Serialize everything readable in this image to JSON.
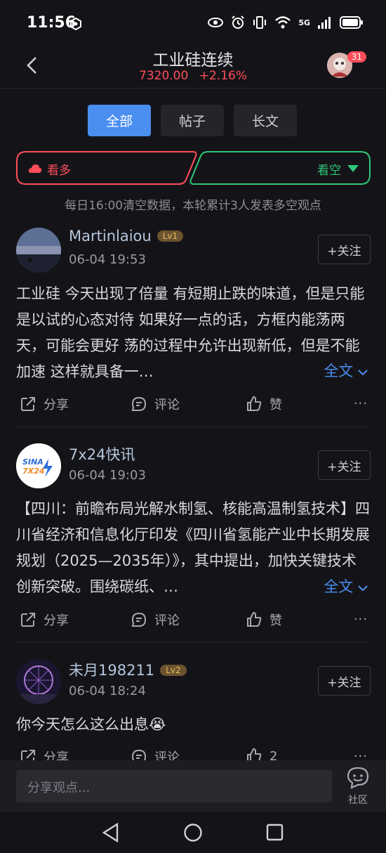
{
  "status_bar": {
    "time": "11:56",
    "network": "5G"
  },
  "header": {
    "title": "工业硅连续",
    "price": "7320.00",
    "change": "+2.16%",
    "notification_count": "31"
  },
  "tabs": [
    {
      "label": "全部",
      "active": true
    },
    {
      "label": "帖子",
      "active": false
    },
    {
      "label": "长文",
      "active": false
    }
  ],
  "sentiment": {
    "bull_label": "看多",
    "bear_label": "看空",
    "note": "每日16:00清空数据，本轮累计3人发表多空观点",
    "bull_color": "#ff4d5a",
    "bear_color": "#2ec777"
  },
  "posts": [
    {
      "username": "Martinlaiou",
      "level": "Lv1",
      "time": "06-04 19:53",
      "follow_label": "+关注",
      "content": "工业硅 今天出现了倍量 有短期止跌的味道，但是只能是以试的心态对待 如果好一点的话，方框内能荡两天，可能会更好 荡的过程中允许出现新低，但是不能加速 这样就具备一…",
      "more_label": "全文",
      "share_label": "分享",
      "comment_label": "评论",
      "like_label": "赞"
    },
    {
      "username": "7x24快讯",
      "level": "",
      "time": "06-04 19:03",
      "follow_label": "+关注",
      "avatar_text_1": "SINA",
      "avatar_text_2": "7X24",
      "content": "【四川：前瞻布局光解水制氢、核能高温制氢技术】四川省经济和信息化厅印发《四川省氢能产业中长期发展规划（2025—2035年）》，其中提出，加快关键技术创新突破。围绕碳纸、…",
      "more_label": "全文",
      "share_label": "分享",
      "comment_label": "评论",
      "like_label": "赞"
    },
    {
      "username": "未月198211",
      "level": "Lv2",
      "time": "06-04 18:24",
      "follow_label": "+关注",
      "content": "你今天怎么这么出息😭",
      "share_label": "分享",
      "comment_label": "评论",
      "like_label": "2"
    }
  ],
  "bottom": {
    "input_placeholder": "分享观点...",
    "community_label": "社区"
  }
}
